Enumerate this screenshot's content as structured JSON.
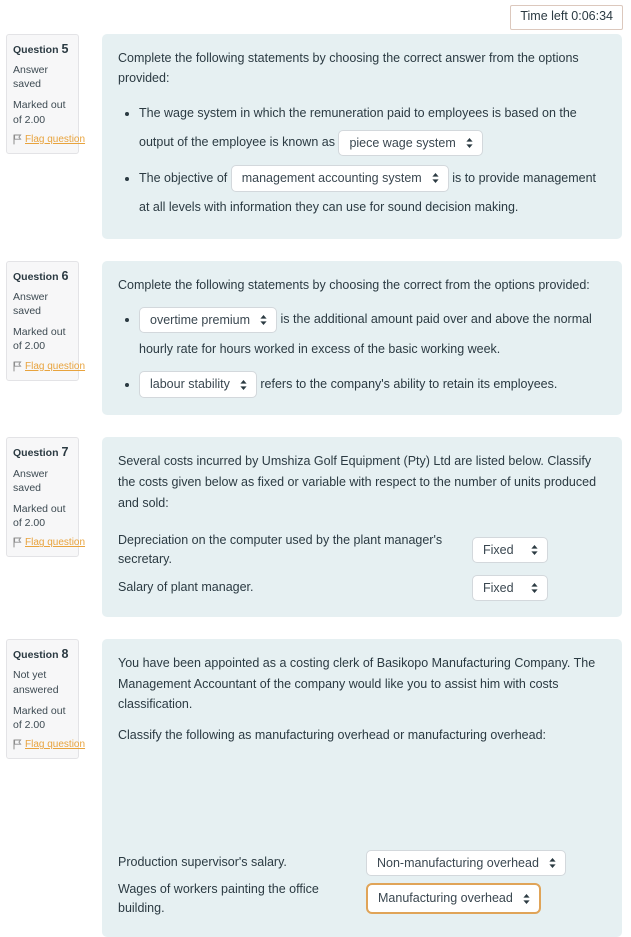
{
  "timer": {
    "label": "Time left 0:06:34"
  },
  "colors": {
    "panel_bg": "#e6f0f2",
    "sidebar_bg": "#f7f7f8",
    "flag_link": "#e8a33d",
    "focus_border": "#e0a458",
    "timer_border": "#dcc8bd"
  },
  "questions": [
    {
      "number_label": "Question",
      "number": "5",
      "state": "Answer saved",
      "marks": "Marked out of 2.00",
      "flag_label": "Flag question",
      "intro": "Complete the following statements by choosing the correct answer from the options provided:",
      "statements": [
        {
          "before": "The wage system in which the remuneration paid to employees is based on the output of the employee is known as",
          "select_value": "piece wage system",
          "after": ""
        },
        {
          "before": "The objective of",
          "select_value": "management accounting system",
          "after": "is to provide management at all levels with information they can use for sound decision making."
        }
      ]
    },
    {
      "number_label": "Question",
      "number": "6",
      "state": "Answer saved",
      "marks": "Marked out of 2.00",
      "flag_label": "Flag question",
      "intro": "Complete the following statements by choosing the correct from the options provided:",
      "statements": [
        {
          "before": "",
          "select_value": "overtime premium",
          "after": "is the additional amount paid over and above the normal hourly rate for hours worked in excess of the basic working week."
        },
        {
          "before": "",
          "select_value": "labour stability",
          "after": "refers to the company's ability to retain its employees."
        }
      ]
    },
    {
      "number_label": "Question",
      "number": "7",
      "state": "Answer saved",
      "marks": "Marked out of 2.00",
      "flag_label": "Flag question",
      "intro": "Several costs incurred by Umshiza Golf Equipment (Pty) Ltd are listed below. Classify the costs given below as fixed or variable with respect to the number of units produced and sold:",
      "rows": [
        {
          "label": "Depreciation on the computer used by the plant manager's secretary.",
          "select_value": "Fixed"
        },
        {
          "label": "Salary of plant manager.",
          "select_value": "Fixed"
        }
      ]
    },
    {
      "number_label": "Question",
      "number": "8",
      "state": "Not yet answered",
      "marks": "Marked out of 2.00",
      "flag_label": "Flag question",
      "intro": "You have been appointed as a costing clerk of Basikopo Manufacturing Company. The Management Accountant of the company would like you to assist him with costs classification.",
      "intro2": "Classify the following as manufacturing overhead or manufacturing overhead:",
      "rows": [
        {
          "label": "Production supervisor's salary.",
          "select_value": "Non-manufacturing overhead"
        },
        {
          "label": "Wages of workers painting the office building.",
          "select_value": "Manufacturing overhead"
        }
      ]
    }
  ]
}
